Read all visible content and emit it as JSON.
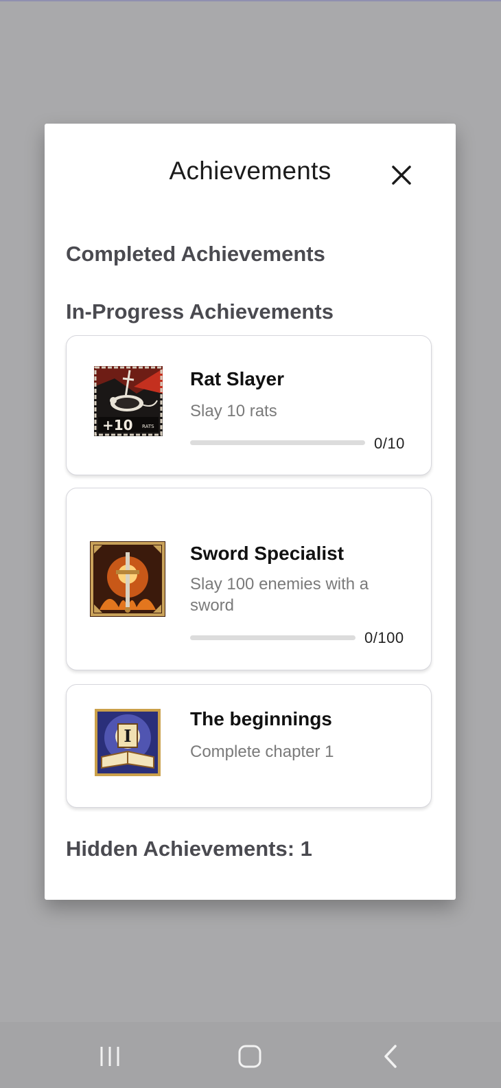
{
  "modal": {
    "title": "Achievements",
    "close_icon": "close-icon"
  },
  "sections": {
    "completed_heading": "Completed Achievements",
    "in_progress_heading": "In-Progress Achievements",
    "hidden_label": "Hidden Achievements: 1"
  },
  "achievements": [
    {
      "title": "Rat Slayer",
      "description": "Slay 10 rats",
      "progress_text": "0/10",
      "progress": 0,
      "icon": "rat-slayer-icon",
      "badge_text": "+10",
      "badge_subtext": "RATS"
    },
    {
      "title": "Sword Specialist",
      "description": "Slay 100 enemies with a sword",
      "progress_text": "0/100",
      "progress": 0,
      "icon": "sword-icon"
    },
    {
      "title": "The beginnings",
      "description": "Complete chapter 1",
      "icon": "book-icon",
      "badge_text": "I"
    }
  ],
  "navbar": {
    "recents_icon": "recents-icon",
    "home_icon": "home-icon",
    "back_icon": "back-icon"
  },
  "colors": {
    "backdrop": "#a9a9ab",
    "modal": "#ffffff",
    "heading": "#4a4a50",
    "progress_track": "#dcdcdc"
  }
}
